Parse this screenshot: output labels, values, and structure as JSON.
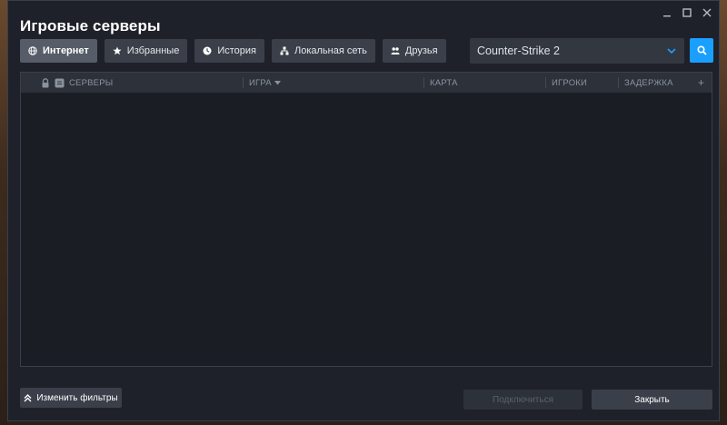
{
  "window": {
    "title": "Игровые серверы",
    "controls": {
      "minimize": "minimize-icon",
      "maximize": "maximize-icon",
      "close": "close-icon"
    }
  },
  "tabs": [
    {
      "label": "Интернет",
      "icon": "globe-icon",
      "active": true
    },
    {
      "label": "Избранные",
      "icon": "star-icon",
      "active": false
    },
    {
      "label": "История",
      "icon": "clock-icon",
      "active": false
    },
    {
      "label": "Локальная сеть",
      "icon": "network-icon",
      "active": false
    },
    {
      "label": "Друзья",
      "icon": "friends-icon",
      "active": false
    }
  ],
  "game_filter": {
    "selected": "Counter-Strike 2",
    "icon": "chevron-down-icon"
  },
  "search": {
    "icon": "search-icon",
    "color": "#1a9fff"
  },
  "server_list": {
    "columns": {
      "servers": "СЕРВЕРЫ",
      "game": "ИГРА",
      "map": "КАРТА",
      "players": "ИГРОКИ",
      "latency": "ЗАДЕРЖКА"
    },
    "add_column": "+",
    "rows": []
  },
  "footer": {
    "change_filters": "Изменить фильтры",
    "connect": "Подключиться",
    "close": "Закрыть"
  },
  "colors": {
    "accent": "#1a9fff",
    "window_bg": "#1e2129",
    "button_bg": "#3a3f4a"
  }
}
